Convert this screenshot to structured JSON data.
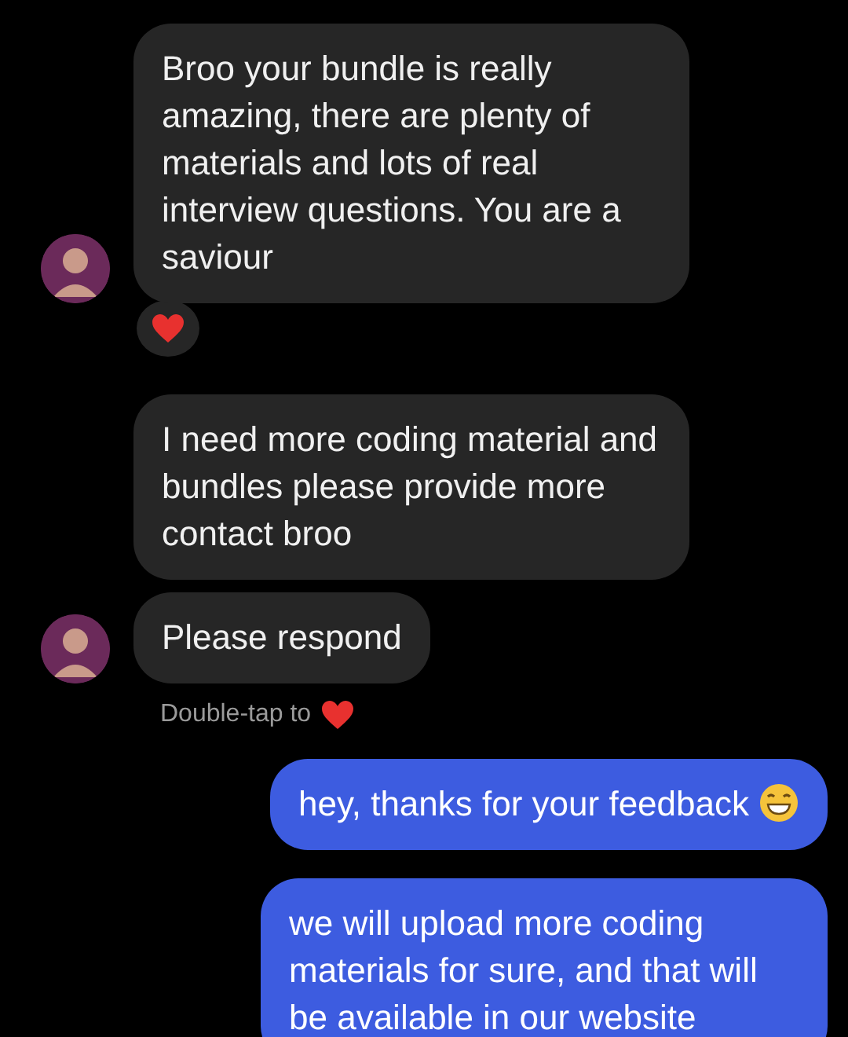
{
  "messages": [
    {
      "kind": "incoming",
      "text": "Broo your bundle is really amazing, there are plenty of materials and lots of real interview questions. You are a saviour",
      "avatar": true,
      "reacted": true
    },
    {
      "kind": "incoming",
      "text": "I need more coding material and bundles please provide more contact broo",
      "avatar": false,
      "reacted": false
    },
    {
      "kind": "incoming",
      "text": "Please respond",
      "avatar": true,
      "reacted": false
    },
    {
      "kind": "hint",
      "text": "Double-tap to"
    },
    {
      "kind": "outgoing",
      "text": "hey, thanks for your feedback",
      "emoji": true
    },
    {
      "kind": "outgoing",
      "text": "we will upload more coding materials for sure, and that will be available in our website",
      "emoji": false
    }
  ]
}
